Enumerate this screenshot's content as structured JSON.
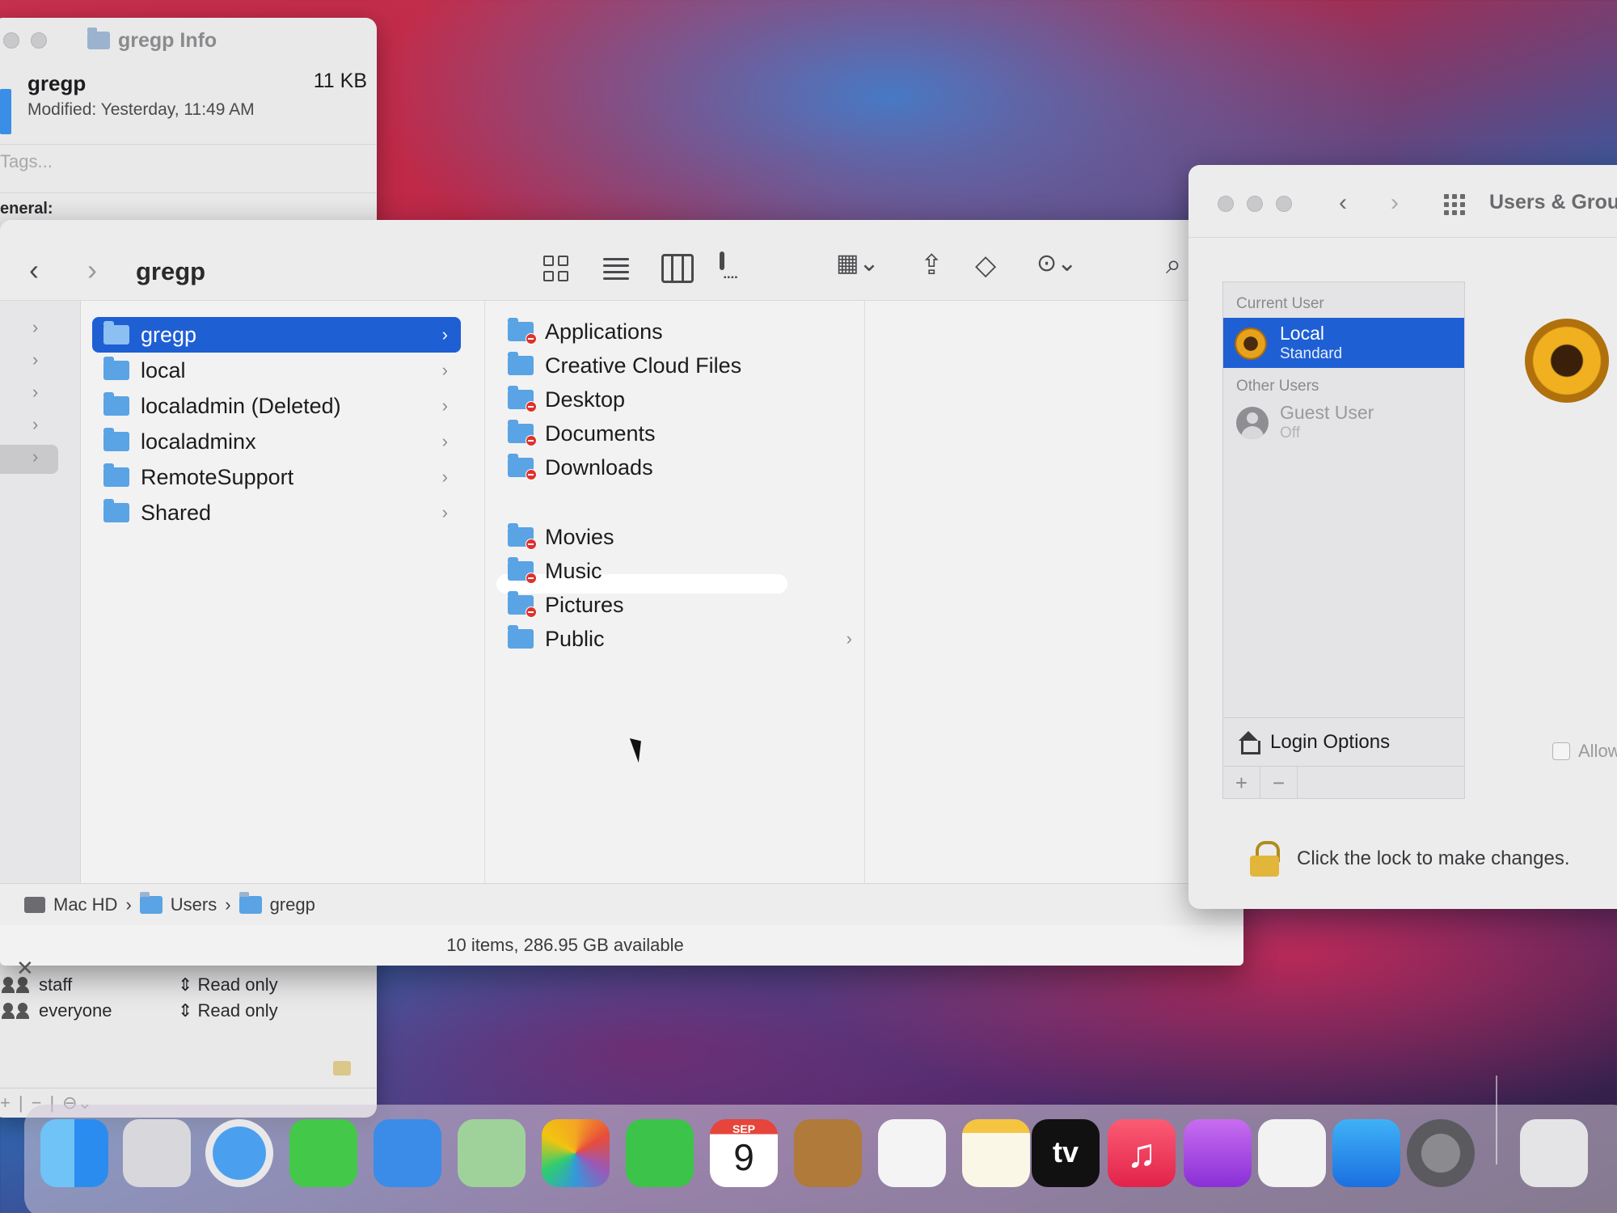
{
  "info_window": {
    "title": "gregp Info",
    "name": "gregp",
    "size": "11 KB",
    "modified": "Modified: Yesterday, 11:49 AM",
    "tags_placeholder": "Tags...",
    "general_label": "eneral:",
    "permissions": [
      {
        "name": "staff",
        "privilege": "Read only"
      },
      {
        "name": "everyone",
        "privilege": "Read only"
      }
    ],
    "footer_controls": [
      "+",
      "|",
      "−",
      "|",
      "⊖",
      "⌄"
    ]
  },
  "finder": {
    "title": "gregp",
    "nav_back": "‹",
    "nav_forward": "›",
    "column1": [
      {
        "label": "gregp",
        "selected": true
      },
      {
        "label": "local",
        "selected": false
      },
      {
        "label": "localadmin (Deleted)",
        "selected": false
      },
      {
        "label": "localadminx",
        "selected": false
      },
      {
        "label": "RemoteSupport",
        "selected": false
      },
      {
        "label": "Shared",
        "selected": false
      }
    ],
    "column2": [
      {
        "label": "Applications",
        "restricted": true
      },
      {
        "label": "Creative Cloud Files",
        "restricted": false
      },
      {
        "label": "Desktop",
        "restricted": true
      },
      {
        "label": "Documents",
        "restricted": true
      },
      {
        "label": "Downloads",
        "restricted": true
      },
      {
        "label": "Movies",
        "restricted": true
      },
      {
        "label": "Music",
        "restricted": true
      },
      {
        "label": "Pictures",
        "restricted": true
      },
      {
        "label": "Public",
        "restricted": false
      }
    ],
    "path": [
      "Mac HD",
      "Users",
      "gregp"
    ],
    "path_separator": "›",
    "status": "10 items, 286.95 GB available"
  },
  "users_groups": {
    "title": "Users & Grou",
    "current_user_header": "Current User",
    "other_users_header": "Other Users",
    "current_user": {
      "name": "Local",
      "role": "Standard"
    },
    "other_user": {
      "name": "Guest User",
      "role": "Off"
    },
    "login_options": "Login Options",
    "add": "+",
    "remove": "−",
    "allow_label": "Allow",
    "lock_text": "Click the lock to make changes."
  },
  "dock": {
    "calendar_month": "SEP",
    "calendar_day": "9",
    "tv_label": "tv",
    "items": [
      "finder-icon",
      "launchpad-icon",
      "safari-icon",
      "messages-icon",
      "mail-icon",
      "maps-icon",
      "photos-icon",
      "facetime-icon",
      "calendar-icon",
      "contacts-icon",
      "reminders-icon",
      "notes-icon",
      "tv-icon",
      "music-icon",
      "podcasts-icon",
      "news-icon",
      "app-store-icon",
      "system-preferences-icon",
      "preview-icon"
    ]
  },
  "colors": {
    "selection_blue": "#1e5fd4",
    "folder_blue": "#5aa3e4",
    "restricted_badge": "#e0312b"
  }
}
